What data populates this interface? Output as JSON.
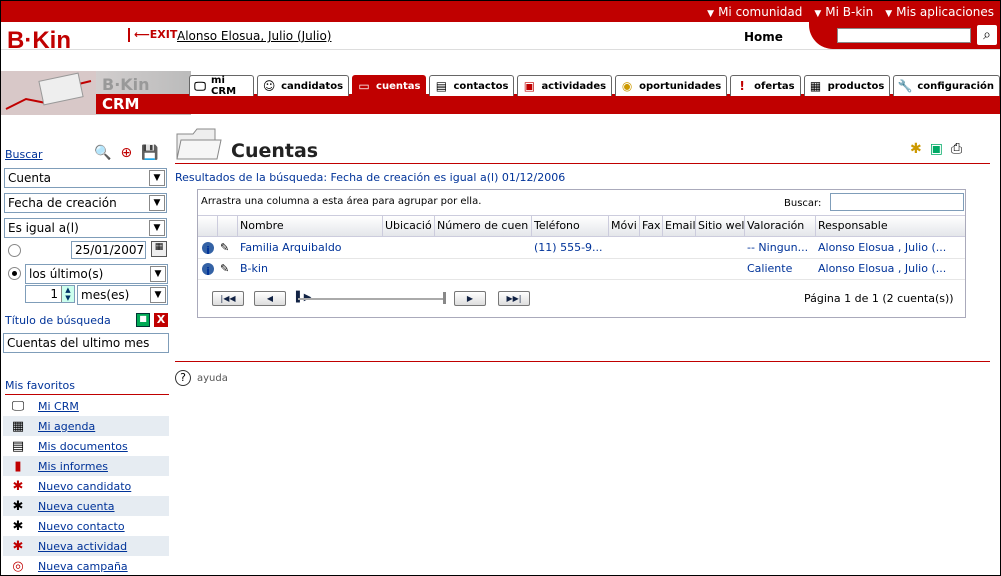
{
  "topnav": [
    "Mi comunidad",
    "Mi B-kin",
    "Mis aplicaciones"
  ],
  "header": {
    "logo": "B·Kin",
    "exit": "EXIT",
    "user": "Alonso Elosua, Julio (Julio)",
    "home": "Home",
    "search_value": ""
  },
  "banner": {
    "bk": "B·Kin",
    "crm": "CRM"
  },
  "tabs": [
    {
      "label": "mi CRM",
      "icon": "monitor-icon"
    },
    {
      "label": "candidatos",
      "icon": "person-icon"
    },
    {
      "label": "cuentas",
      "icon": "folder-icon",
      "active": true
    },
    {
      "label": "contactos",
      "icon": "card-icon"
    },
    {
      "label": "actividades",
      "icon": "activity-icon"
    },
    {
      "label": "oportunidades",
      "icon": "coins-icon"
    },
    {
      "label": "ofertas",
      "icon": "exclamation-icon"
    },
    {
      "label": "productos",
      "icon": "box-icon"
    },
    {
      "label": "configuración",
      "icon": "wrench-icon"
    }
  ],
  "sidebar": {
    "buscar": "Buscar",
    "select_entity": "Cuenta",
    "select_field": "Fecha de creación",
    "select_op": "Es igual a(l)",
    "date": "25/01/2007",
    "range": "los último(s)",
    "qty": "1",
    "unit": "mes(es)",
    "titulo_label": "Título de búsqueda",
    "titulo_value": "Cuentas del ultimo mes",
    "fav_header": "Mis favoritos",
    "favorites": [
      {
        "label": "Mi CRM",
        "icon": "monitor-icon"
      },
      {
        "label": "Mi agenda",
        "icon": "calendar-icon"
      },
      {
        "label": "Mis documentos",
        "icon": "document-icon"
      },
      {
        "label": "Mis informes",
        "icon": "chart-icon"
      },
      {
        "label": "Nuevo candidato",
        "icon": "new-person-icon"
      },
      {
        "label": "Nueva cuenta",
        "icon": "new-folder-icon"
      },
      {
        "label": "Nuevo contacto",
        "icon": "new-card-icon"
      },
      {
        "label": "Nueva actividad",
        "icon": "new-activity-icon"
      },
      {
        "label": "Nueva campaña",
        "icon": "target-icon"
      }
    ]
  },
  "main": {
    "title": "Cuentas",
    "results": "Resultados de la búsqueda: Fecha de creación es igual a(l) 01/12/2006",
    "group_hint": "Arrastra una columna a esta área para agrupar por ella.",
    "grid_search_label": "Buscar:",
    "columns": [
      "Nombre",
      "Ubicació",
      "Número de cuen",
      "Teléfono",
      "Móvi",
      "Fax",
      "Email",
      "Sitio wel",
      "Valoración",
      "Responsable"
    ],
    "rows": [
      [
        "Familia Arquibaldo",
        "",
        "",
        "(11) 555-9...",
        "",
        "",
        "",
        "",
        "-- Ningun...",
        "Alonso Elosua , Julio (..."
      ],
      [
        "B-kin",
        "",
        "",
        "",
        "",
        "",
        "",
        "",
        "Caliente",
        "Alonso Elosua , Julio (..."
      ]
    ],
    "page_info": "Página 1 de 1 (2 cuenta(s))",
    "ayuda": "ayuda"
  }
}
